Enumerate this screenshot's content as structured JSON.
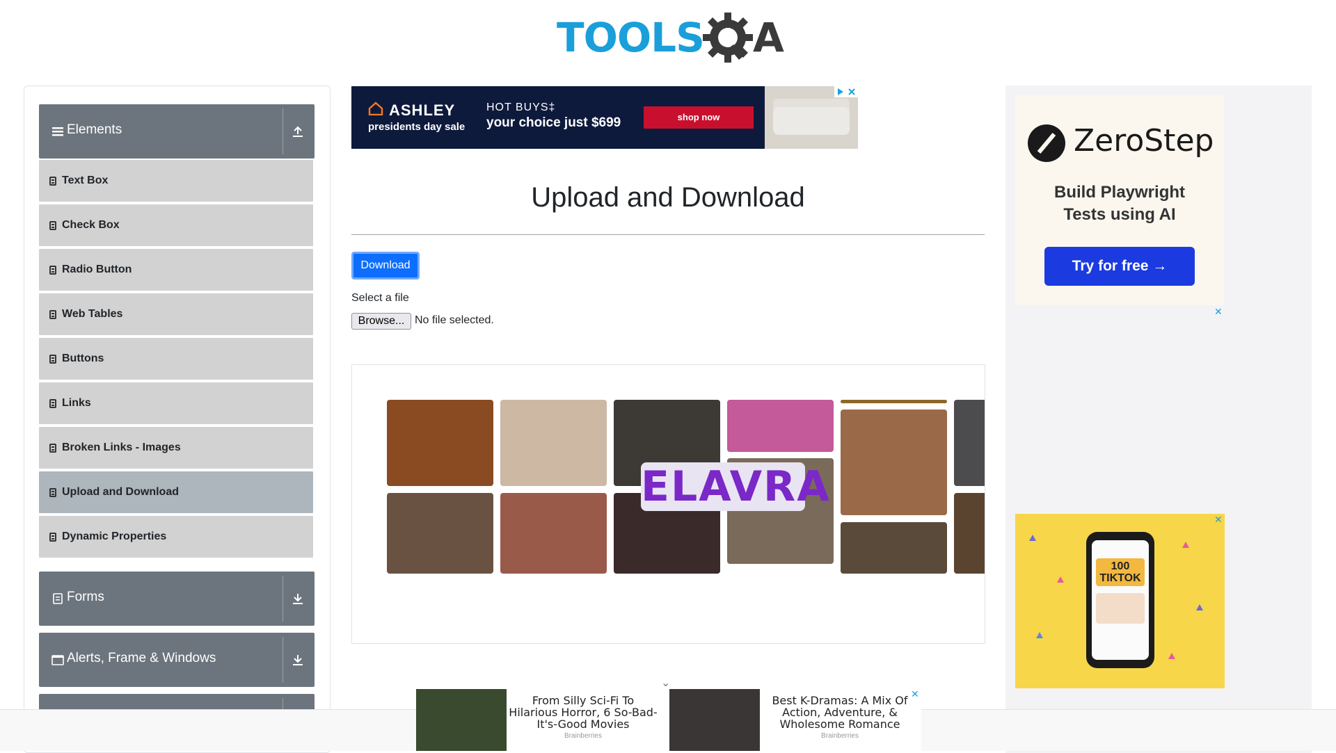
{
  "logo": {
    "tools": "TOOLS",
    "qa": "QA"
  },
  "sidebar": {
    "elements_header": "Elements",
    "items": [
      {
        "label": "Text Box"
      },
      {
        "label": "Check Box"
      },
      {
        "label": "Radio Button"
      },
      {
        "label": "Web Tables"
      },
      {
        "label": "Buttons"
      },
      {
        "label": "Links"
      },
      {
        "label": "Broken Links - Images"
      },
      {
        "label": "Upload and Download",
        "active": true
      },
      {
        "label": "Dynamic Properties"
      }
    ],
    "forms_header": "Forms",
    "alerts_header": "Alerts, Frame & Windows"
  },
  "top_ad": {
    "brand": "ASHLEY",
    "brand_sub": "presidents day sale",
    "hot": "HOT BUYS‡",
    "choice": "your choice just $699",
    "cta": "shop now"
  },
  "main": {
    "title": "Upload and Download",
    "download_label": "Download",
    "select_label": "Select a file",
    "browse_label": "Browse...",
    "no_file": "No file selected.",
    "gallery_brand": "ELAVRA"
  },
  "right_ad": {
    "brand": "ZeroStep",
    "tagline_1": "Build Playwright",
    "tagline_2": "Tests using AI",
    "cta": "Try for free →",
    "close": "✕"
  },
  "tiktok_ad": {
    "card": "100\nTIKTOK",
    "close": "✕"
  },
  "bottom_ad": {
    "item1_title": "From Silly Sci-Fi To Hilarious Horror, 6 So-Bad-It's-Good Movies",
    "item1_src": "Brainberries",
    "item2_title": "Best K-Dramas: A Mix Of Action, Adventure, & Wholesome Romance",
    "item2_src": "Brainberries",
    "close": "✕"
  },
  "colors": {
    "sidebar_header": "#6c757d",
    "menu_item": "#d2d2d2",
    "menu_item_active": "#adb5bd",
    "primary_button": "#0d6efd",
    "logo_blue": "#1a9fda"
  }
}
